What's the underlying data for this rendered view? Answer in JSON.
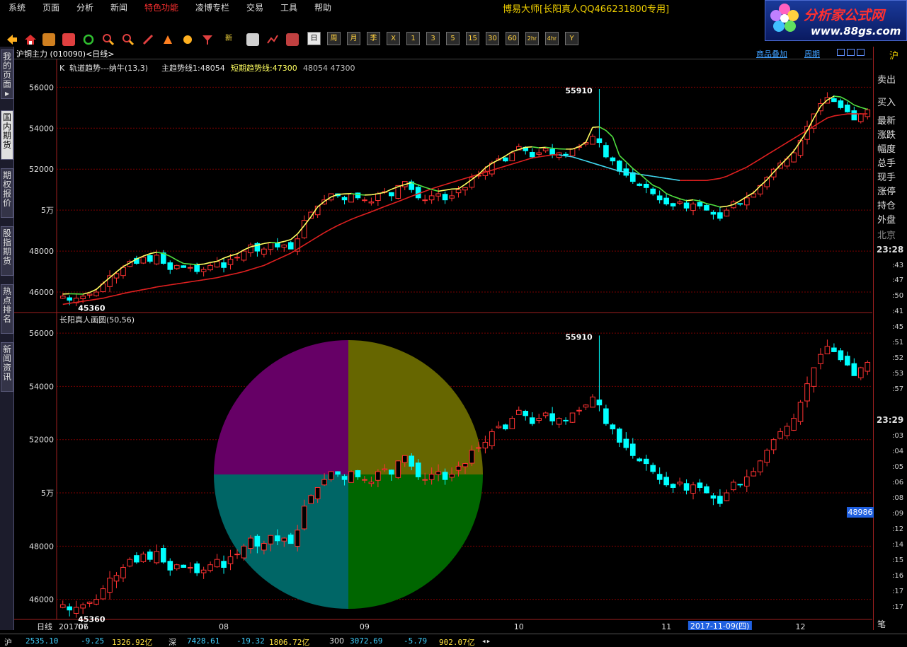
{
  "menu": [
    "系统",
    "页面",
    "分析",
    "新闻",
    "特色功能",
    "凌博专栏",
    "交易",
    "工具",
    "帮助"
  ],
  "menu_highlight_color": "#ff3030",
  "app_title": "博易大师[长阳真人QQ466231800专用]",
  "logo": {
    "text": "分析家公式网",
    "url": "www.88gs.com"
  },
  "toolbar_buttons": [
    {
      "label": "新"
    },
    {
      "label": "日",
      "active": true
    },
    {
      "label": "周"
    },
    {
      "label": "月"
    },
    {
      "label": "季"
    },
    {
      "label": "X"
    },
    {
      "label": "1"
    },
    {
      "label": "3"
    },
    {
      "label": "5"
    },
    {
      "label": "15"
    },
    {
      "label": "30"
    },
    {
      "label": "60"
    },
    {
      "label": "2hr"
    },
    {
      "label": "4hr"
    },
    {
      "label": "Y"
    }
  ],
  "side_tabs": [
    {
      "label": "我的页面▸"
    },
    {
      "label": "国内期货",
      "active": true
    },
    {
      "label": "期权报价"
    },
    {
      "label": "股指期货"
    },
    {
      "label": "热点排名"
    },
    {
      "label": "新闻资讯"
    }
  ],
  "header": {
    "symbol": "沪铜主力",
    "code": "(010090)",
    "period": "<日线>",
    "links": [
      "商品叠加",
      "周期"
    ]
  },
  "top_panel": {
    "legend_prefix": "K",
    "indicator_name": "轨道趋势---纳牛(13,3)",
    "main_trend_label": "主趋势线1:48054",
    "short_trend_label": "短期趋势线:47300",
    "extra_values": "48054  47300",
    "high_label": "55910",
    "low_label": "45360"
  },
  "bottom_panel": {
    "indicator_name": "长阳真人画圆(50,56)",
    "high_label": "55910",
    "low_label": "45360"
  },
  "x_axis": {
    "period_label": "日线",
    "start_label": "201706",
    "month_labels": [
      "07",
      "08",
      "09",
      "10",
      "11",
      "12"
    ],
    "cursor_date": "2017-11-09(四)"
  },
  "colors": {
    "up": "#ff3232",
    "down": "#00ffff",
    "grid": "#7a0000",
    "short_trend_up": "#ffff60",
    "short_trend_down": "#50e040",
    "main_trend_up": "#e02020",
    "main_trend_down": "#40d8f0",
    "circle_tl": "#660066",
    "circle_tr": "#666600",
    "circle_bl": "#006666",
    "circle_br": "#006600"
  },
  "chart_data": {
    "type": "candlestick",
    "y_axis_ticks": [
      "56000",
      "54000",
      "52000",
      "5万",
      "48000",
      "46000"
    ],
    "y_axis_tick_values": [
      56000,
      54000,
      52000,
      50000,
      48000,
      46000
    ],
    "top_ylim": [
      45000,
      56600
    ],
    "bottom_ylim": [
      45300,
      56400
    ],
    "x_count": 121,
    "month_start_index": [
      3,
      24,
      45,
      68,
      90,
      110
    ],
    "high_index": 80,
    "low_index": 1,
    "cursor_index": 98,
    "closes": [
      45800,
      45600,
      45700,
      45800,
      45900,
      46000,
      46400,
      46800,
      46900,
      47200,
      47500,
      47400,
      47700,
      47500,
      47800,
      47400,
      47100,
      47300,
      47200,
      47200,
      47000,
      47100,
      47300,
      47500,
      47200,
      47600,
      47700,
      48000,
      48300,
      48000,
      48100,
      48400,
      48200,
      48300,
      48100,
      48600,
      49500,
      49900,
      50200,
      50500,
      50800,
      50700,
      50500,
      50800,
      50600,
      50500,
      50400,
      50800,
      50900,
      50700,
      51200,
      51400,
      51000,
      50600,
      50500,
      50700,
      50800,
      50500,
      50700,
      51000,
      51100,
      51600,
      51700,
      51900,
      52300,
      52500,
      52400,
      52800,
      53100,
      52900,
      52600,
      52800,
      53000,
      52700,
      52800,
      52700,
      53000,
      53100,
      53300,
      53600,
      53300,
      52600,
      52400,
      51900,
      51700,
      51400,
      51200,
      51100,
      50800,
      50500,
      50300,
      50200,
      50400,
      50100,
      50300,
      50200,
      50000,
      49800,
      49600,
      50000,
      50400,
      50300,
      50600,
      50800,
      51200,
      51600,
      52000,
      52300,
      52500,
      52800,
      53400,
      54100,
      54700,
      55200,
      55500,
      55300,
      55000,
      54800,
      54400,
      54700,
      54900
    ],
    "main_trend": [
      45400,
      45450,
      45500,
      45550,
      45600,
      45650,
      45700,
      45780,
      45850,
      45930,
      46000,
      46060,
      46120,
      46180,
      46250,
      46300,
      46350,
      46400,
      46450,
      46500,
      46550,
      46600,
      46650,
      46700,
      46780,
      46850,
      46920,
      47000,
      47100,
      47200,
      47300,
      47450,
      47600,
      47750,
      47900,
      48100,
      48300,
      48500,
      48700,
      48900,
      49080,
      49250,
      49400,
      49550,
      49680,
      49800,
      49920,
      50050,
      50180,
      50300,
      50420,
      50550,
      50680,
      50800,
      50920,
      51040,
      51150,
      51250,
      51350,
      51450,
      51550,
      51650,
      51750,
      51850,
      51950,
      52050,
      52150,
      52250,
      52350,
      52450,
      52550,
      52600,
      52650,
      52700,
      52700,
      52650,
      52600,
      52500,
      52400,
      52300,
      52200,
      52100,
      52000,
      51900,
      51850,
      51800,
      51750,
      51700,
      51650,
      51600,
      51550,
      51500,
      51450,
      51450,
      51450,
      51450,
      51450,
      51500,
      51550,
      51650,
      51800,
      51950,
      52100,
      52300,
      52500,
      52700,
      52900,
      53100,
      53300,
      53500,
      53700,
      53900,
      54100,
      54300,
      54500,
      54600,
      54650,
      54700,
      54700,
      54700,
      54700
    ]
  }
}
